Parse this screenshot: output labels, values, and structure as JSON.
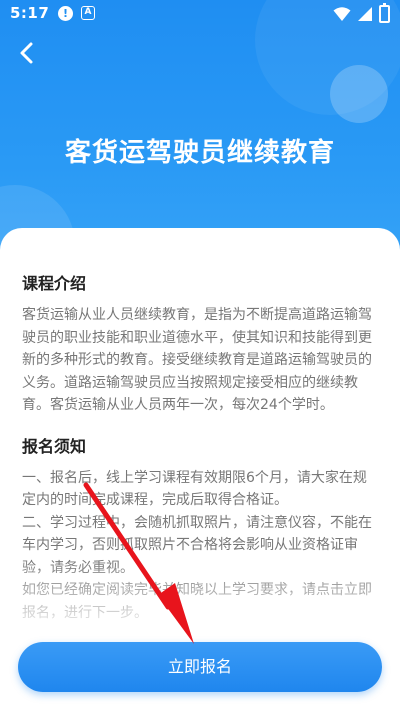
{
  "status_bar": {
    "time": "5:17",
    "alert_glyph": "!",
    "badge_glyph": "A",
    "icons": [
      "alert-icon",
      "text-badge-icon",
      "wifi-icon",
      "signal-icon",
      "battery-icon"
    ]
  },
  "header": {
    "title": "客货运驾驶员继续教育",
    "back_icon": "chevron-left-icon",
    "background_color": "#1f8ef2"
  },
  "sections": [
    {
      "title": "课程介绍",
      "body": "客货运输从业人员继续教育，是指为不断提高道路运输驾驶员的职业技能和职业道德水平，使其知识和技能得到更新的多种形式的教育。接受继续教育是道路运输驾驶员的义务。道路运输驾驶员应当按照规定接受相应的继续教育。客货运输从业人员两年一次，每次24个学时。"
    },
    {
      "title": "报名须知",
      "body": "一、报名后，线上学习课程有效期限6个月，请大家在规定内的时间完成课程，完成后取得合格证。\n二、学习过程中，会随机抓取照片，请注意仪容，不能在车内学习，否则抓取照片不合格将会影响从业资格证审验，请务必重视。\n如您已经确定阅读完毕并知晓以上学习要求，请点击立即报名，进行下一步。"
    }
  ],
  "cta": {
    "label": "立即报名",
    "color": "#1f86ee"
  },
  "annotation": {
    "arrow_color": "#e8141c"
  }
}
